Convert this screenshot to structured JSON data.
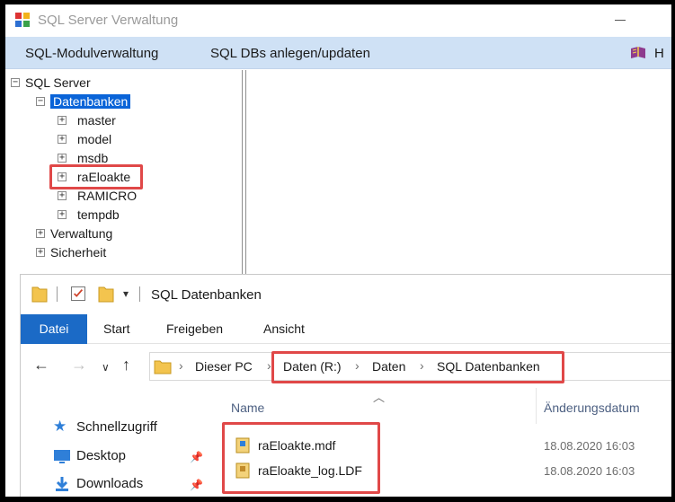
{
  "sql_window": {
    "title": "SQL Server Verwaltung",
    "menu": {
      "modules": "SQL-Modulverwaltung",
      "databases": "SQL DBs anlegen/updaten",
      "help_icon": "book-icon",
      "help_label": "H"
    },
    "tree": {
      "root": "SQL Server",
      "databases_node": "Datenbanken",
      "databases": [
        "master",
        "model",
        "msdb",
        "raEloakte",
        "RAMICRO",
        "tempdb"
      ],
      "management": "Verwaltung",
      "security": "Sicherheit"
    }
  },
  "explorer": {
    "title": "SQL Datenbanken",
    "ribbon": {
      "file": "Datei",
      "home": "Start",
      "share": "Freigeben",
      "view": "Ansicht"
    },
    "breadcrumb": {
      "this_pc": "Dieser PC",
      "drive": "Daten (R:)",
      "folder": "Daten",
      "subfolder": "SQL Datenbanken"
    },
    "nav": {
      "quick_access": "Schnellzugriff",
      "desktop": "Desktop",
      "downloads": "Downloads"
    },
    "columns": {
      "name": "Name",
      "modified": "Änderungsdatum"
    },
    "files": [
      {
        "name": "raEloakte.mdf",
        "modified": "18.08.2020 16:03"
      },
      {
        "name": "raEloakte_log.LDF",
        "modified": "18.08.2020 16:03"
      }
    ]
  },
  "colors": {
    "selection": "#0a64d8",
    "menubar": "#cfe1f5",
    "ribbon_active": "#1b6ac6",
    "highlight_box": "#e04848",
    "folder": "#f3c44e"
  }
}
